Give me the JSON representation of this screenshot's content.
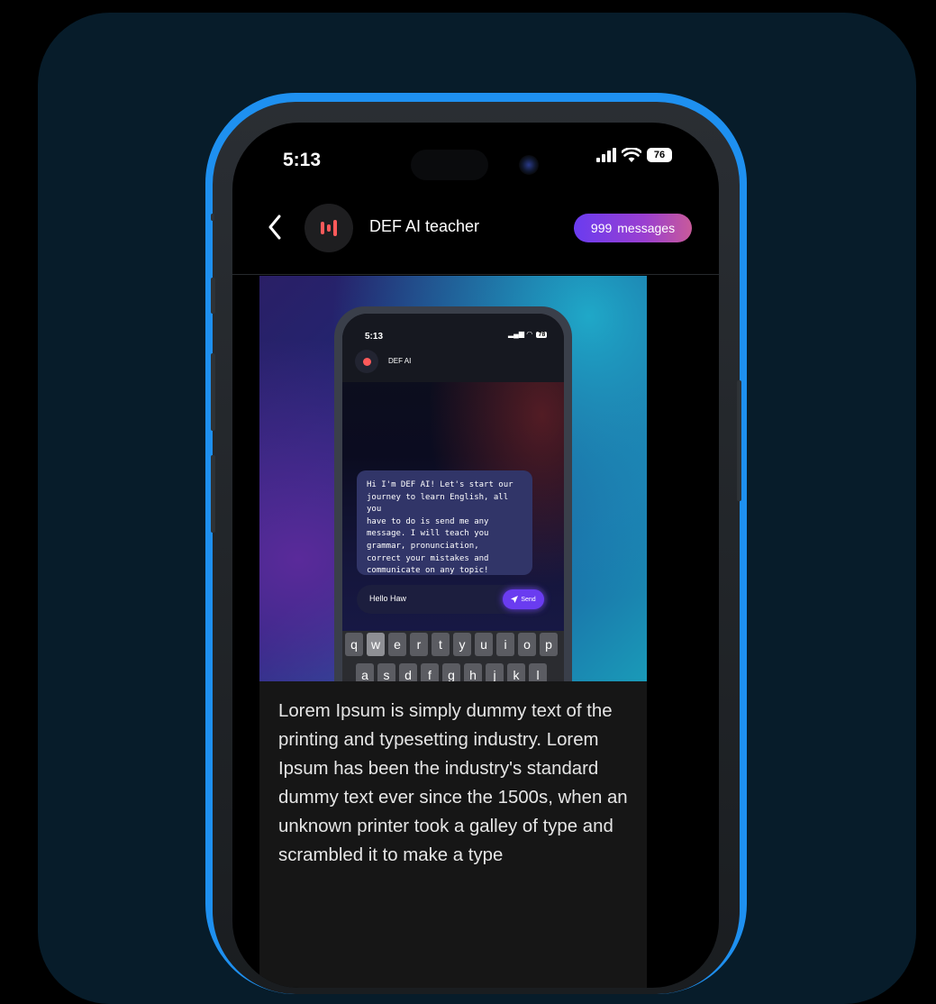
{
  "status_bar": {
    "time": "5:13",
    "battery": "76"
  },
  "header": {
    "back_icon": "chevron-left-icon",
    "avatar_icon": "voice-bars-icon",
    "title": "DEF AI teacher",
    "badge_count": "999",
    "badge_label": "messages"
  },
  "media": {
    "status_time": "5:13",
    "status_battery": "78",
    "chat_name": "DEF AI",
    "bubble_text": "Hi I'm DEF AI! Let's start our\njourney to learn English, all you\nhave to do is send me any\nmessage. I will teach you\ngrammar, pronunciation,\ncorrect your mistakes and\ncommunicate on any topic!",
    "input_value": "Hello Haw",
    "send_label": "Send",
    "keyboard_row1": [
      "q",
      "w",
      "e",
      "r",
      "t",
      "y",
      "u",
      "i",
      "o",
      "p"
    ],
    "keyboard_row2": [
      "a",
      "s",
      "d",
      "f",
      "g",
      "h",
      "j",
      "k",
      "l"
    ]
  },
  "message_text": "Lorem Ipsum is simply dummy text of the printing and typesetting industry. Lorem Ipsum has been the industry's standard dummy text ever since the 1500s, when an unknown printer took a galley of type and scrambled it to make a type",
  "colors": {
    "background": "#000000",
    "card": "#071c2a",
    "phone_accent": "#1e90f0",
    "badge_gradient_start": "#6a3cf0",
    "badge_gradient_end": "#c85a9a",
    "avatar_icon": "#ff5a5a"
  }
}
